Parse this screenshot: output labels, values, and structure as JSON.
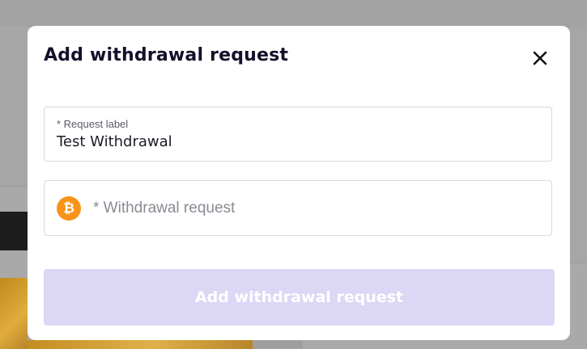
{
  "modal": {
    "title": "Add withdrawal request",
    "close_icon": "close-icon"
  },
  "form": {
    "request_label": {
      "label": "* Request label",
      "value": "Test Withdrawal"
    },
    "withdrawal_request": {
      "icon": "bitcoin-icon",
      "icon_glyph": "₿",
      "icon_color": "#f7931a",
      "placeholder": "* Withdrawal request"
    }
  },
  "actions": {
    "submit_label": "Add withdrawal request",
    "submit_color": "#dcd7f5"
  }
}
